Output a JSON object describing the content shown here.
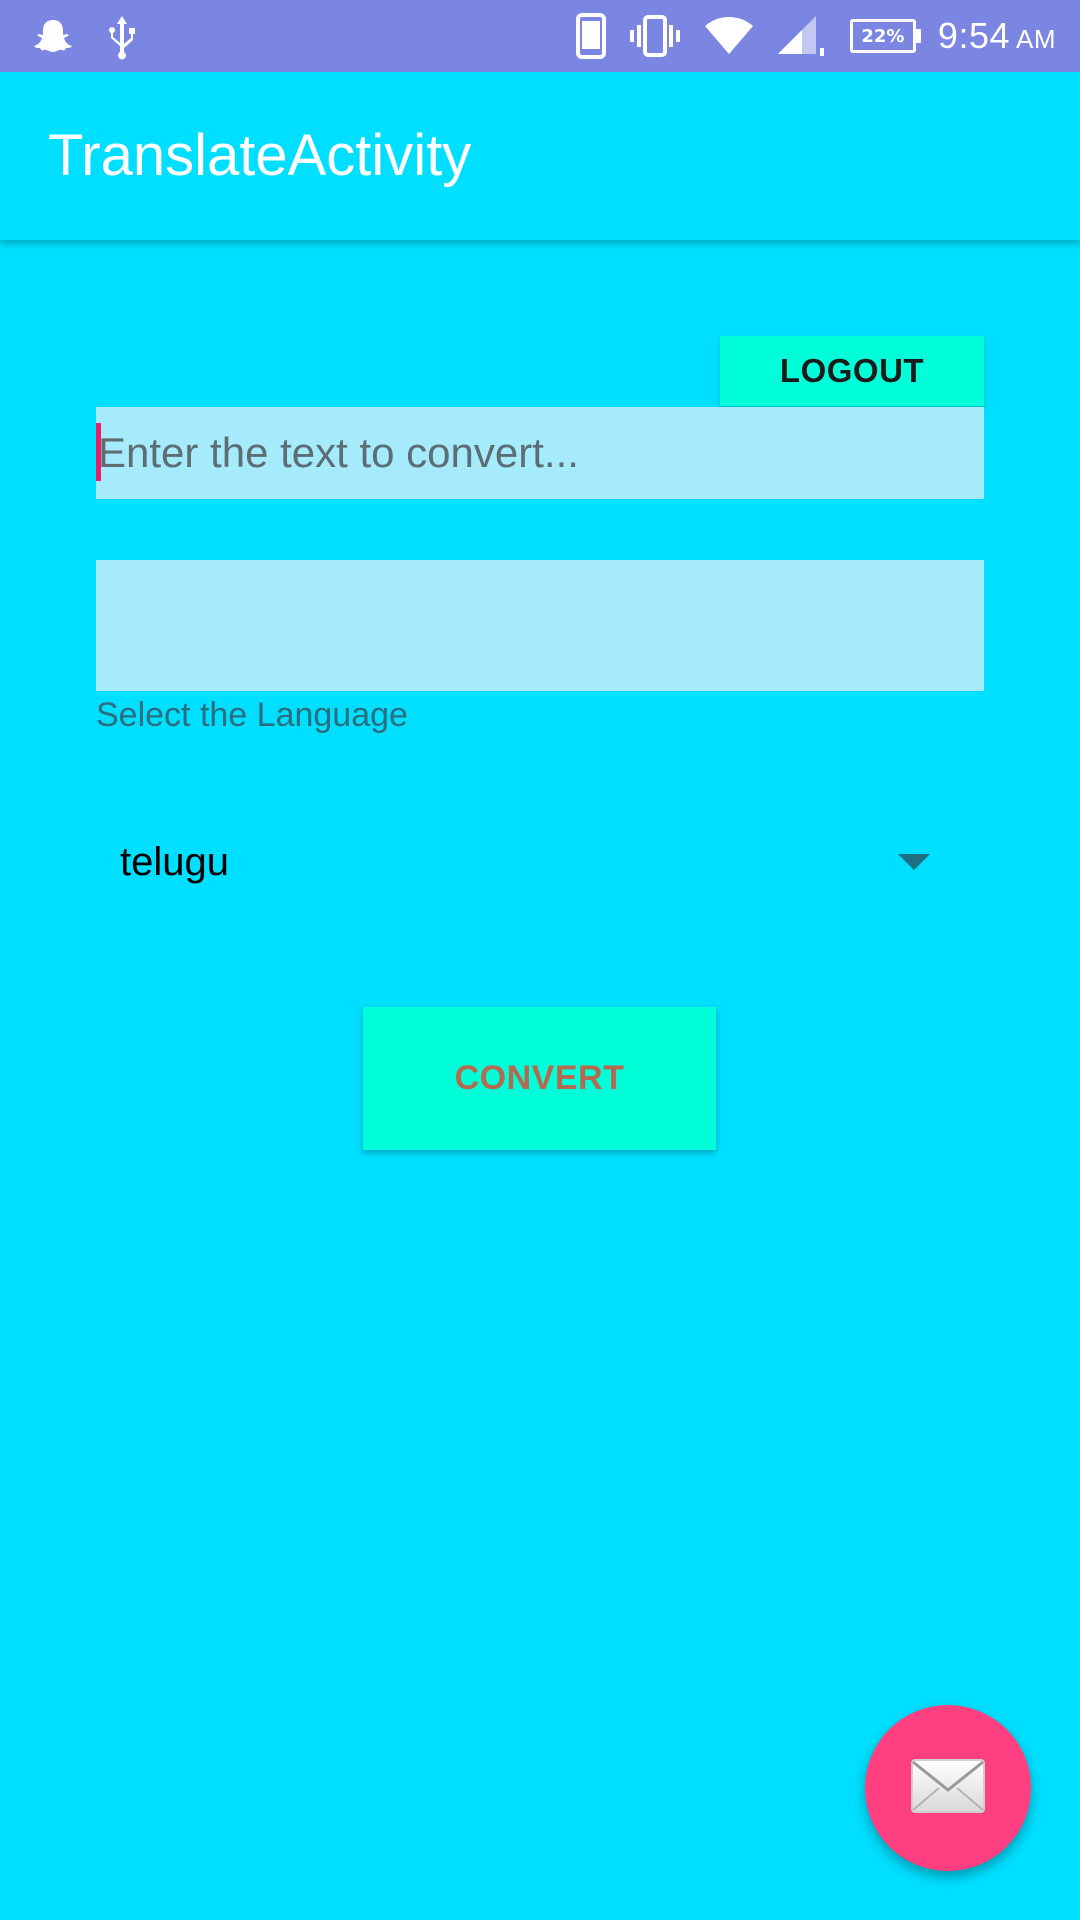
{
  "status_bar": {
    "time": "9:54",
    "ampm": "AM",
    "battery_percent": "22%",
    "icons": [
      "snapchat-icon",
      "usb-icon",
      "phone-icon",
      "vibrate-icon",
      "wifi-icon",
      "cell-signal-icon",
      "battery-icon"
    ]
  },
  "app_bar": {
    "title": "TranslateActivity"
  },
  "main": {
    "logout_label": "LOGOUT",
    "input": {
      "placeholder": "Enter the text to convert...",
      "value": ""
    },
    "output_text": "",
    "language_label": "Select the Language",
    "language_selected": "telugu",
    "convert_label": "CONVERT"
  },
  "fab": {
    "icon": "envelope-icon"
  },
  "colors": {
    "background": "#00DFFF",
    "status_bar": "#7B86E2",
    "button": "#00FFD8",
    "input_bg": "#A6EBFC",
    "fab": "#FF3F7F",
    "convert_text": "#B5694F"
  }
}
